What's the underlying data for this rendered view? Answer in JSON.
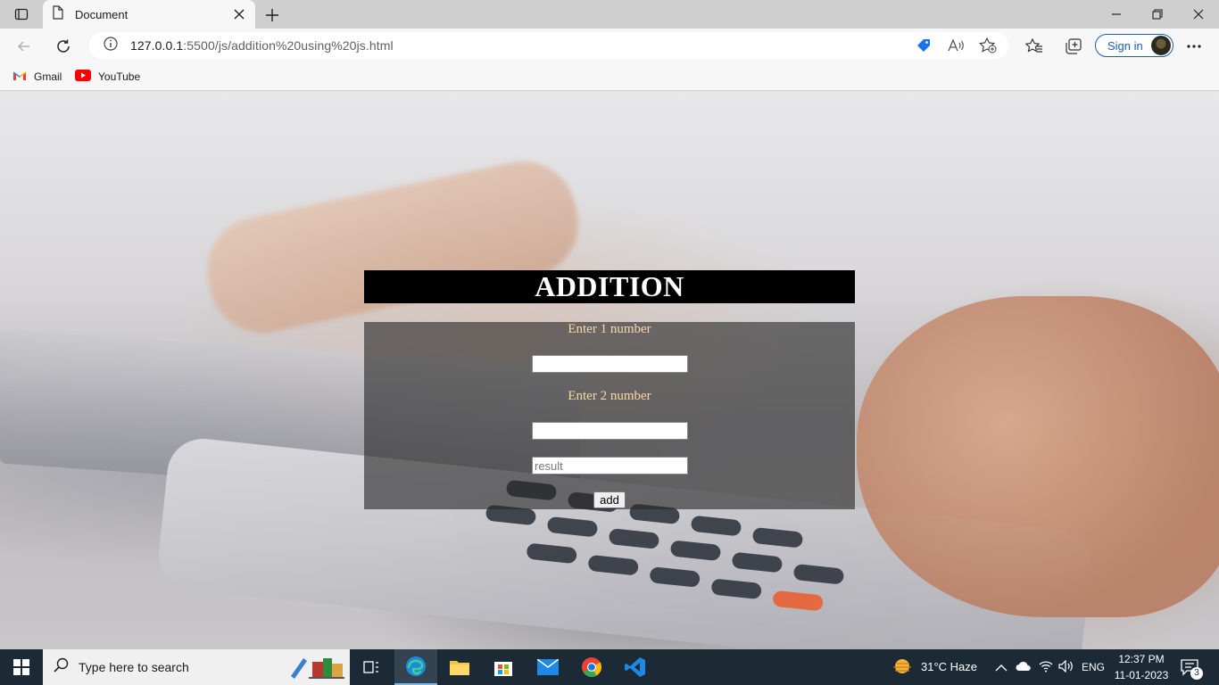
{
  "browser": {
    "tab_title": "Document",
    "url_host": "127.0.0.1",
    "url_path": ":5500/js/addition%20using%20js.html",
    "signin_label": "Sign in",
    "bookmarks": [
      {
        "label": "Gmail",
        "icon": "gmail-icon"
      },
      {
        "label": "YouTube",
        "icon": "youtube-icon"
      }
    ]
  },
  "page": {
    "heading": "ADDITION",
    "label1": "Enter 1 number",
    "label2": "Enter 2 number",
    "input1_value": "",
    "input2_value": "",
    "result_placeholder": "result",
    "add_button": "add"
  },
  "taskbar": {
    "search_placeholder": "Type here to search",
    "weather": "31°C  Haze",
    "language": "ENG",
    "time": "12:37 PM",
    "date": "11-01-2023",
    "notification_count": "3"
  },
  "colors": {
    "heading_bg": "#000000",
    "label_color": "#f6d9a8",
    "form_bg": "rgba(40,40,40,0.62)",
    "taskbar_bg": "#1c2a36"
  }
}
